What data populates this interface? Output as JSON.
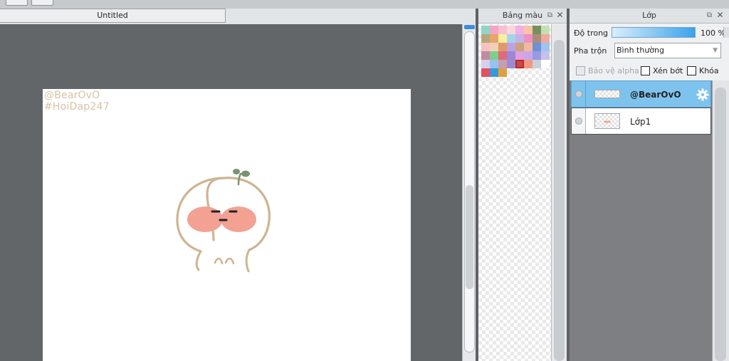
{
  "document": {
    "tab_title": "Untitled",
    "canvas_watermark": [
      "@BearOvO",
      "#HoiDap247"
    ]
  },
  "palette_panel": {
    "title": "Bảng màu",
    "popout_icon": "popout-icon",
    "close_icon": "close-icon",
    "swatch_rows": [
      [
        "#8dd6c8",
        "#f3a4c8",
        "#f7bfd0",
        "#f6d7dc",
        "#f3b0e0",
        "#f7c4a8",
        "#78905f",
        "#c5e0b0"
      ],
      [
        "#b4a87a",
        "#e6a56a",
        "#f7ef9a",
        "#a6d2ed",
        "#c4b3e6",
        "#ee90c3",
        "#a78e7a",
        "#f1a99d"
      ],
      [
        "#f5c0c0",
        "#f3cfb8",
        "#e09a68",
        "#bfa1e0",
        "#c7a47c",
        "#f0b9a0",
        "#6f8fd6",
        "#9fc4ec"
      ],
      [
        "#c28aa0",
        "#7fcf8a",
        "#e0697a",
        "#9d86d6",
        "#e0a0e0",
        "#c9a6ea",
        "#9a9ae0",
        "#c6c0ec"
      ],
      [
        "#d3d0ea",
        "#96c2ec",
        "#c49fb0",
        "#9d8ad2",
        "#b85050",
        "#f09a82",
        "#c8d0d8",
        "#ffffff"
      ],
      [
        "#e05060",
        "#3a98d8",
        "#e0a040"
      ]
    ],
    "selected_swatch": "4-4"
  },
  "layer_panel": {
    "title": "Lớp",
    "opacity_label": "Độ trong",
    "opacity_value": "100 %",
    "opacity_fraction": 1.0,
    "blend_label": "Pha trộn",
    "blend_value": "Bình thường",
    "checkboxes": {
      "protect_alpha": "Bảo vệ alpha",
      "clipping": "Xén bớt",
      "lock": "Khóa"
    },
    "layers": [
      {
        "name": "@BearOvO",
        "selected": true
      },
      {
        "name": "Lớp1",
        "selected": false
      }
    ],
    "colors": {
      "selected_row": "#7ec3ee",
      "list_background": "#7d7f82",
      "workspace": "#636669"
    }
  }
}
